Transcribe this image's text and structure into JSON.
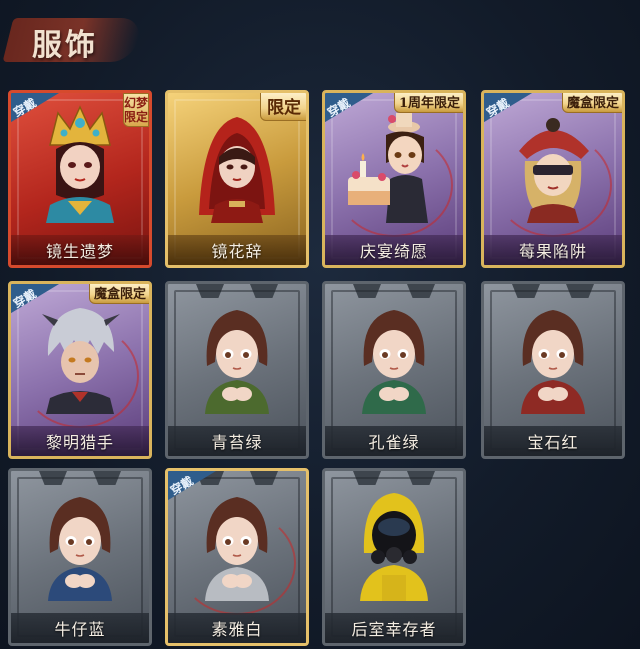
{
  "header": {
    "title": "服饰"
  },
  "colors": {
    "background": "#121b29",
    "equip_badge": "#2f5d8c",
    "red_card": "#b3261d",
    "gold_card": "#c99b3d",
    "purple_card": "#8c72ad",
    "gray_card": "#6b727b"
  },
  "equip_label": "穿戴",
  "cards": [
    {
      "name": "镜生遗梦",
      "tag": "幻梦限定",
      "equipped": true,
      "style": "red",
      "icon": "bride-crown-portrait"
    },
    {
      "name": "镜花辞",
      "tag": "限定",
      "equipped": false,
      "style": "gold",
      "icon": "red-hood-portrait"
    },
    {
      "name": "庆宴绮愿",
      "tag": "1周年限定",
      "equipped": true,
      "style": "purple",
      "icon": "party-hat-cake-portrait"
    },
    {
      "name": "莓果陷阱",
      "tag": "魔盒限定",
      "equipped": true,
      "style": "purple",
      "icon": "blindfold-hat-portrait"
    },
    {
      "name": "黎明猎手",
      "tag": "魔盒限定",
      "equipped": true,
      "style": "purple",
      "icon": "silver-hair-hunter-portrait"
    },
    {
      "name": "青苔绿",
      "tag": "",
      "equipped": false,
      "style": "gray",
      "icon": "girl-green-coat-portrait"
    },
    {
      "name": "孔雀绿",
      "tag": "",
      "equipped": false,
      "style": "gray",
      "icon": "girl-peacock-coat-portrait"
    },
    {
      "name": "宝石红",
      "tag": "",
      "equipped": false,
      "style": "gray",
      "icon": "girl-red-coat-portrait"
    },
    {
      "name": "牛仔蓝",
      "tag": "",
      "equipped": false,
      "style": "gray",
      "icon": "girl-blue-coat-portrait"
    },
    {
      "name": "素雅白",
      "tag": "",
      "equipped": true,
      "style": "gray",
      "icon": "girl-white-coat-portrait"
    },
    {
      "name": "后室幸存者",
      "tag": "",
      "equipped": false,
      "style": "gray",
      "icon": "hazmat-gasmask-portrait"
    }
  ]
}
